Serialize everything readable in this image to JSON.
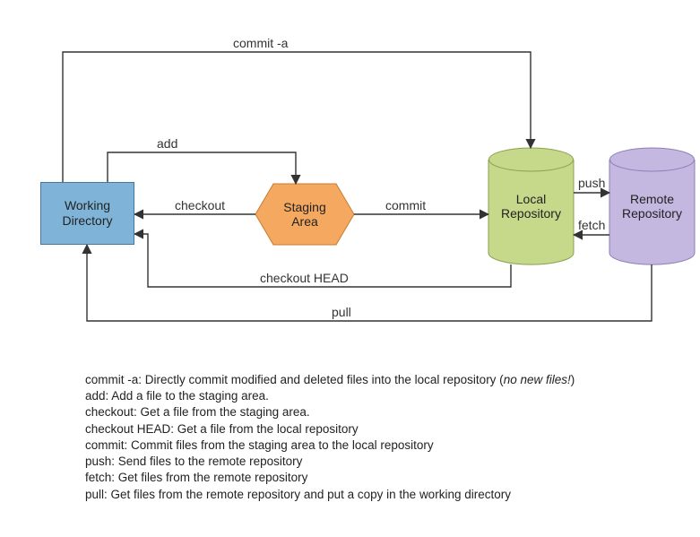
{
  "nodes": {
    "working": "Working\nDirectory",
    "staging": "Staging\nArea",
    "local": "Local\nRepository",
    "remote": "Remote\nRepository"
  },
  "edges": {
    "commit_a": "commit -a",
    "add": "add",
    "checkout": "checkout",
    "commit": "commit",
    "push": "push",
    "fetch": "fetch",
    "checkout_head": "checkout HEAD",
    "pull": "pull"
  },
  "legend": {
    "l1a": "commit -a: Directly commit modified and deleted files into the local repository (",
    "l1b": "no new files!",
    "l1c": ")",
    "l2": "add: Add a file to the staging area.",
    "l3": "checkout: Get a file from the staging area.",
    "l4": "checkout HEAD: Get a file from the local repository",
    "l5": "commit: Commit files from the staging area to the local repository",
    "l6": "push: Send files to the remote repository",
    "l7": "fetch: Get files from the remote repository",
    "l8": "pull: Get files from the remote repository and put a copy in the working directory"
  },
  "chart_data": {
    "type": "flow",
    "nodes": [
      {
        "id": "working",
        "label": "Working Directory",
        "shape": "rect",
        "fill": "#7fb4d8"
      },
      {
        "id": "staging",
        "label": "Staging Area",
        "shape": "hexagon",
        "fill": "#f4a860"
      },
      {
        "id": "local",
        "label": "Local Repository",
        "shape": "cylinder",
        "fill": "#c6d88a"
      },
      {
        "id": "remote",
        "label": "Remote Repository",
        "shape": "cylinder",
        "fill": "#c4b7e0"
      }
    ],
    "edges": [
      {
        "from": "working",
        "to": "local",
        "label": "commit -a"
      },
      {
        "from": "working",
        "to": "staging",
        "label": "add"
      },
      {
        "from": "staging",
        "to": "working",
        "label": "checkout"
      },
      {
        "from": "staging",
        "to": "local",
        "label": "commit"
      },
      {
        "from": "local",
        "to": "remote",
        "label": "push"
      },
      {
        "from": "remote",
        "to": "local",
        "label": "fetch"
      },
      {
        "from": "local",
        "to": "working",
        "label": "checkout HEAD"
      },
      {
        "from": "remote",
        "to": "working",
        "label": "pull"
      }
    ]
  }
}
